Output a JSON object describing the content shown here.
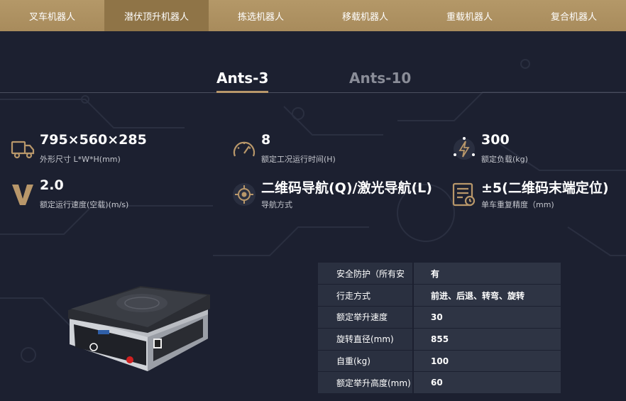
{
  "nav": {
    "items": [
      "叉车机器人",
      "潜伏顶升机器人",
      "拣选机器人",
      "移载机器人",
      "重载机器人",
      "复合机器人"
    ],
    "active_index": 1
  },
  "tabs": [
    {
      "label": "Ants-3",
      "active": true
    },
    {
      "label": "Ants-10",
      "active": false
    }
  ],
  "specs": [
    {
      "icon": "truck-icon",
      "value": "795×560×285",
      "label": "外形尺寸 L*W*H(mm)"
    },
    {
      "icon": "speedometer-icon",
      "value": "8",
      "label": "额定工况运行时间(H)"
    },
    {
      "icon": "power-icon",
      "value": "300",
      "label": "额定负载(kg)"
    },
    {
      "icon": "v-letter-icon",
      "value": "2.0",
      "label": "额定运行速度(空载)(m/s)"
    },
    {
      "icon": "crosshair-icon",
      "value": "二维码导航(Q)/激光导航(L)",
      "label": "导航方式"
    },
    {
      "icon": "document-clock-icon",
      "value": "±5(二维码末端定位)",
      "label": "单车重复精度（mm)"
    }
  ],
  "table": [
    {
      "key": "安全防护（所有安",
      "value": "有"
    },
    {
      "key": "行走方式",
      "value": "前进、后退、转弯、旋转"
    },
    {
      "key": "额定举升速度",
      "value": "30"
    },
    {
      "key": "旋转直径(mm)",
      "value": "855"
    },
    {
      "key": "自重(kg)",
      "value": "100"
    },
    {
      "key": "额定举升高度(mm)",
      "value": "60"
    }
  ],
  "colors": {
    "accent": "#b49868",
    "bg": "#1c2030",
    "nav_active": "#8f7447"
  }
}
